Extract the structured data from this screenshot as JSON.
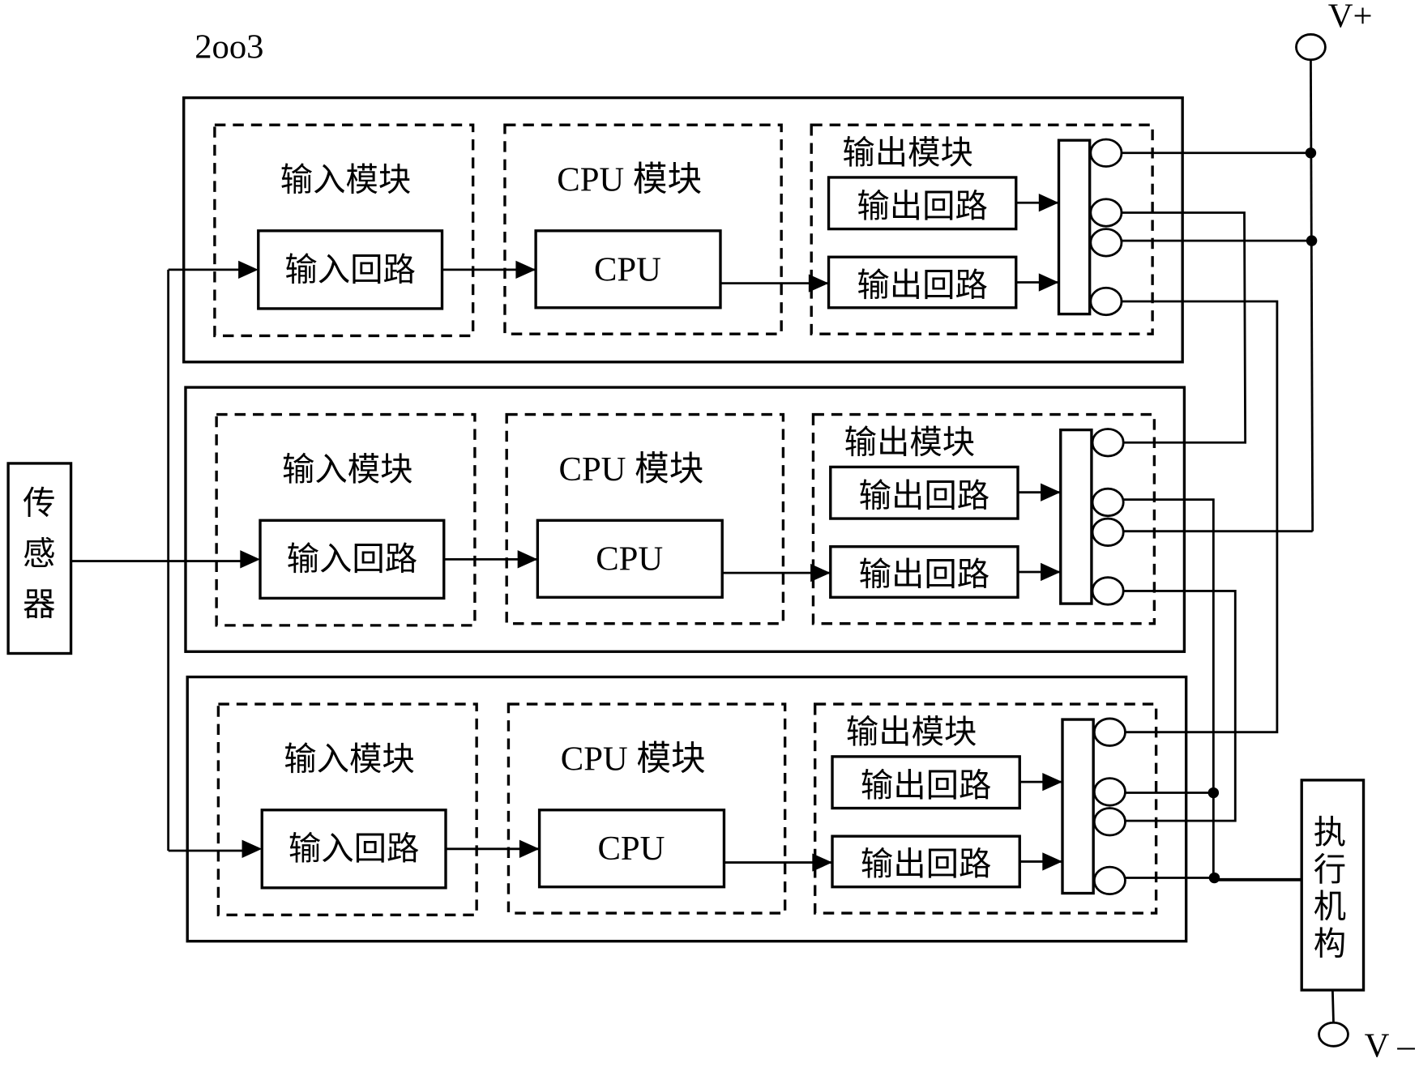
{
  "title": "2oo3",
  "sensor": {
    "label_chars": [
      "传",
      "感",
      "器"
    ]
  },
  "actuator": {
    "label_chars": [
      "执",
      "行",
      "机",
      "构"
    ]
  },
  "supply": {
    "positive": "V+",
    "negative": "V –"
  },
  "channels": [
    {
      "input_module": "输入模块",
      "input_circuit": "输入回路",
      "cpu_module": "CPU 模块",
      "cpu": "CPU",
      "output_module": "输出模块",
      "output_circuits": [
        "输出回路",
        "输出回路"
      ]
    },
    {
      "input_module": "输入模块",
      "input_circuit": "输入回路",
      "cpu_module": "CPU 模块",
      "cpu": "CPU",
      "output_module": "输出模块",
      "output_circuits": [
        "输出回路",
        "输出回路"
      ]
    },
    {
      "input_module": "输入模块",
      "input_circuit": "输入回路",
      "cpu_module": "CPU 模块",
      "cpu": "CPU",
      "output_module": "输出模块",
      "output_circuits": [
        "输出回路",
        "输出回路"
      ]
    }
  ]
}
